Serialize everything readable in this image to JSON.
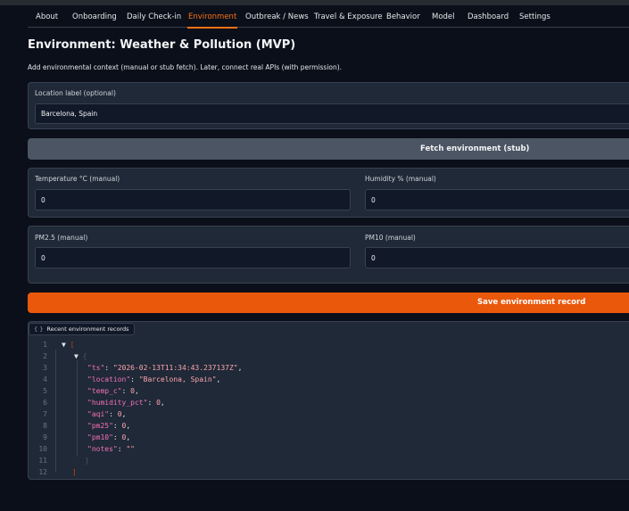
{
  "tabs": [
    {
      "label": "About"
    },
    {
      "label": "Onboarding"
    },
    {
      "label": "Daily Check-in"
    },
    {
      "label": "Environment",
      "active": true
    },
    {
      "label": "Outbreak / News"
    },
    {
      "label": "Travel & Exposure"
    },
    {
      "label": "Behavior"
    },
    {
      "label": "Model"
    },
    {
      "label": "Dashboard"
    },
    {
      "label": "Settings"
    }
  ],
  "page": {
    "title": "Environment: Weather & Pollution (MVP)",
    "description": "Add environmental context (manual or stub fetch). Later, connect real APIs (with permission)."
  },
  "location": {
    "label": "Location label (optional)",
    "value": "Barcelona, Spain"
  },
  "fetch_button": "Fetch environment (stub)",
  "temperature": {
    "label": "Temperature °C (manual)",
    "value": "0"
  },
  "humidity": {
    "label": "Humidity % (manual)",
    "value": "0"
  },
  "pm25": {
    "label": "PM2.5 (manual)",
    "value": "0"
  },
  "pm10": {
    "label": "PM10 (manual)",
    "value": "0"
  },
  "save_button": "Save environment record",
  "records": {
    "chip_label": "Recent environment records",
    "chip_icon": "{ }",
    "lines": [
      {
        "n": "1",
        "arrow": "▼",
        "text": "[",
        "kind": "open"
      },
      {
        "n": "2",
        "arrow": "▼",
        "text": "{",
        "kind": "open2"
      },
      {
        "n": "3",
        "key": "\"ts\"",
        "val": "\"2026-02-13T11:34:43.237137Z\"",
        "comma": ","
      },
      {
        "n": "4",
        "key": "\"location\"",
        "val": "\"Barcelona, Spain\"",
        "comma": ","
      },
      {
        "n": "5",
        "key": "\"temp_c\"",
        "val": "0",
        "comma": ","
      },
      {
        "n": "6",
        "key": "\"humidity_pct\"",
        "val": "0",
        "comma": ","
      },
      {
        "n": "7",
        "key": "\"aqi\"",
        "val": "0",
        "comma": ","
      },
      {
        "n": "8",
        "key": "\"pm25\"",
        "val": "0",
        "comma": ","
      },
      {
        "n": "9",
        "key": "\"pm10\"",
        "val": "0",
        "comma": ","
      },
      {
        "n": "10",
        "key": "\"notes\"",
        "val": "\"\"",
        "comma": ""
      },
      {
        "n": "11",
        "text": "}",
        "kind": "close2"
      },
      {
        "n": "12",
        "text": "]",
        "kind": "close"
      }
    ]
  },
  "colors": {
    "accent": "#f97316",
    "primary_button": "#ea580c",
    "background": "#0b0f19",
    "panel": "#1f2937"
  }
}
